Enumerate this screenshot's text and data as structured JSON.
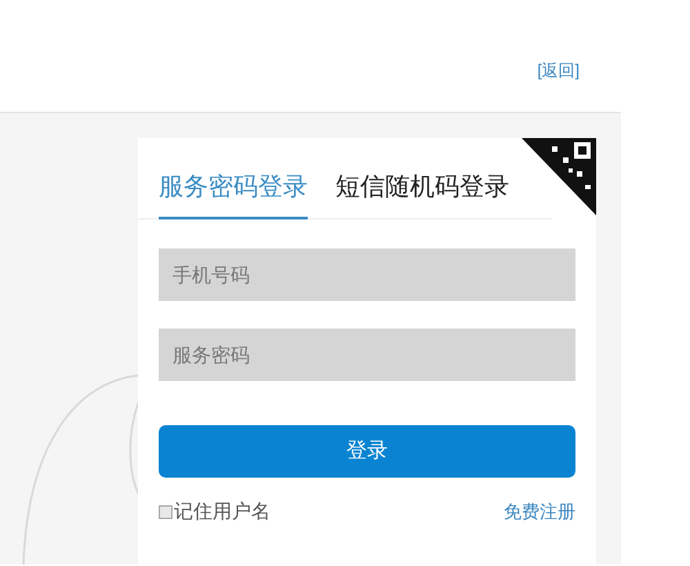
{
  "header": {
    "back_link": "[返回]"
  },
  "tabs": [
    {
      "label": "服务密码登录",
      "selected": true
    },
    {
      "label": "短信随机码登录",
      "selected": false
    }
  ],
  "fields": [
    {
      "placeholder": "手机号码"
    },
    {
      "placeholder": "服务密码"
    }
  ],
  "login_button": "登录",
  "remember": {
    "label": "记住用户名",
    "checked": false
  },
  "register_link": "免费注册"
}
